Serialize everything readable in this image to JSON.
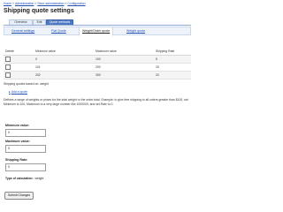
{
  "breadcrumb": {
    "items": [
      "Home",
      "Administration",
      "Store administration",
      "Configuration"
    ],
    "separator": "»"
  },
  "page_title": "Shipping quote settings",
  "primary_tabs": [
    {
      "label": "Overview",
      "active": false
    },
    {
      "label": "Edit",
      "active": false
    },
    {
      "label": "Quote methods",
      "active": true
    }
  ],
  "secondary_tabs": [
    {
      "label": "General settings",
      "active": false
    },
    {
      "label": "Flat Quote",
      "active": false
    },
    {
      "label": "Weight/Order quote",
      "active": true
    },
    {
      "label": "Weight quote",
      "active": false
    }
  ],
  "table": {
    "headers": [
      "Delete",
      "Minimum value",
      "Maximum value",
      "Shipping Rate"
    ],
    "rows": [
      {
        "min": "0",
        "max": "100",
        "rate": "5"
      },
      {
        "min": "101",
        "max": "200",
        "rate": "15"
      },
      {
        "min": "202",
        "max": "300",
        "rate": "20"
      }
    ]
  },
  "basis_text": "Shipping quotes based on: weight",
  "add_quote": {
    "icon": "plus-icon",
    "label": "Add a quote"
  },
  "description": "Defines a range of weights or prices for the total weight or the order total. Example: to give free shipping to all orders greater than $100, set Minimum to 100, Maximum to a very large number like 1000000, and set Rate to 0.",
  "form": {
    "min": {
      "label": "Minimum value:",
      "value": "0"
    },
    "max": {
      "label": "Maximum value:",
      "value": "0"
    },
    "rate": {
      "label": "Shipping Rate:",
      "value": "0"
    },
    "calc_label": "Type of calculation:",
    "calc_value": "weight"
  },
  "submit_label": "Submit Changes"
}
